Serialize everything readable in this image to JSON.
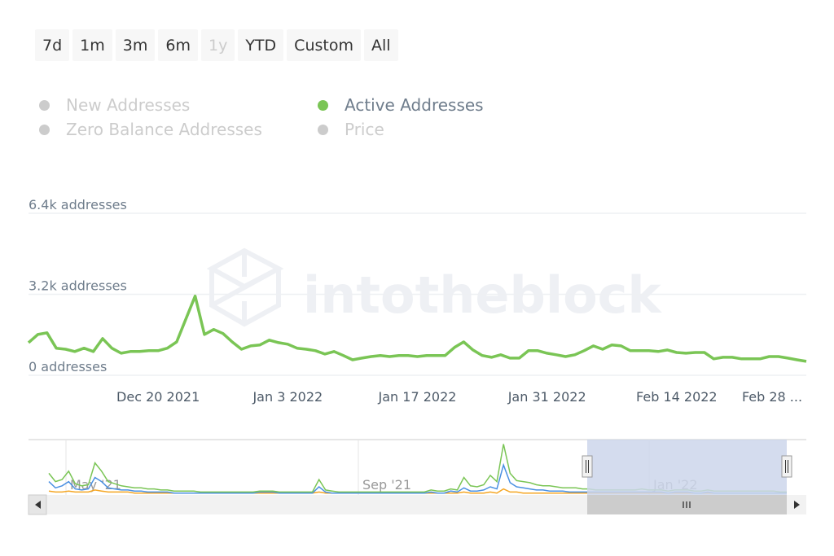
{
  "range_selector": {
    "buttons": [
      {
        "label": "7d",
        "enabled": true
      },
      {
        "label": "1m",
        "enabled": true
      },
      {
        "label": "3m",
        "enabled": true
      },
      {
        "label": "6m",
        "enabled": true
      },
      {
        "label": "1y",
        "enabled": false
      },
      {
        "label": "YTD",
        "enabled": true
      },
      {
        "label": "Custom",
        "enabled": true
      },
      {
        "label": "All",
        "enabled": true
      }
    ]
  },
  "legend": {
    "items": [
      {
        "label": "New Addresses",
        "active": false
      },
      {
        "label": "Active Addresses",
        "active": true
      },
      {
        "label": "Zero Balance Addresses",
        "active": false
      },
      {
        "label": "Price",
        "active": false
      }
    ]
  },
  "watermark": {
    "text": "intotheblock"
  },
  "colors": {
    "active_series": "#7ac555",
    "new_series": "#4a90e2",
    "zero_series": "#f5a623",
    "inactive_legend": "#cccccc",
    "axis_text": "#6f7d8c",
    "navigator_mask": "#ccd6eb"
  },
  "chart_data": {
    "type": "line",
    "title": "",
    "xlabel": "",
    "ylabel": "",
    "y_unit": "addresses",
    "ylim": [
      0,
      6400
    ],
    "y_ticks": [
      {
        "value": 0,
        "label": "0 addresses"
      },
      {
        "value": 3200,
        "label": "3.2k addresses"
      },
      {
        "value": 6400,
        "label": "6.4k addresses"
      }
    ],
    "x_start": "2021-12-06",
    "x_end": "2022-02-28",
    "x_ticks": [
      {
        "day": 14,
        "label": "Dec 20 2021"
      },
      {
        "day": 28,
        "label": "Jan 3 2022"
      },
      {
        "day": 42,
        "label": "Jan 17 2022"
      },
      {
        "day": 56,
        "label": "Jan 31 2022"
      },
      {
        "day": 70,
        "label": "Feb 14 2022"
      },
      {
        "day": 84,
        "label": "Feb 28 ..."
      }
    ],
    "grid": true,
    "series": [
      {
        "name": "Active Addresses",
        "values": [
          1290,
          1610,
          1680,
          1070,
          1030,
          940,
          1070,
          940,
          1450,
          1070,
          870,
          940,
          940,
          970,
          970,
          1070,
          1320,
          2230,
          3130,
          1610,
          1810,
          1650,
          1320,
          1030,
          1160,
          1200,
          1390,
          1290,
          1230,
          1070,
          1030,
          970,
          840,
          940,
          780,
          610,
          680,
          740,
          780,
          740,
          780,
          780,
          740,
          780,
          780,
          780,
          1100,
          1320,
          1000,
          780,
          710,
          810,
          680,
          680,
          970,
          970,
          870,
          810,
          740,
          810,
          970,
          1160,
          1030,
          1200,
          1160,
          970,
          970,
          970,
          940,
          1000,
          900,
          870,
          900,
          900,
          650,
          710,
          710,
          650,
          650,
          650,
          740,
          740,
          680,
          610,
          550
        ]
      }
    ],
    "navigator": {
      "labels": [
        "May '21",
        "Sep '21",
        "Jan '22"
      ],
      "selected_range": [
        "2021-12-06",
        "2022-02-28"
      ],
      "series": [
        {
          "name": "Active Addresses",
          "values": [
            20,
            12,
            14,
            22,
            10,
            8,
            9,
            30,
            22,
            12,
            10,
            8,
            7,
            6,
            6,
            5,
            5,
            4,
            4,
            3,
            3,
            3,
            3,
            2,
            2,
            2,
            2,
            2,
            2,
            2,
            2,
            2,
            3,
            3,
            3,
            2,
            2,
            2,
            2,
            2,
            2,
            14,
            4,
            3,
            2,
            2,
            2,
            2,
            2,
            2,
            2,
            2,
            2,
            2,
            2,
            2,
            2,
            2,
            4,
            3,
            3,
            5,
            4,
            16,
            8,
            7,
            9,
            18,
            12,
            48,
            20,
            13,
            12,
            11,
            9,
            8,
            8,
            7,
            6,
            6,
            6,
            5,
            5,
            4,
            4,
            4,
            4,
            4,
            4,
            4,
            5,
            4,
            4,
            4,
            3,
            4,
            4,
            4,
            3,
            3,
            4,
            3,
            3,
            3,
            3,
            3,
            3,
            3,
            3,
            3,
            3,
            2,
            2
          ]
        },
        {
          "name": "New Addresses",
          "values": [
            12,
            6,
            8,
            12,
            5,
            4,
            5,
            16,
            12,
            6,
            5,
            4,
            4,
            3,
            3,
            2,
            2,
            2,
            2,
            1,
            1,
            1,
            1,
            1,
            1,
            1,
            1,
            1,
            1,
            1,
            1,
            1,
            2,
            2,
            2,
            1,
            1,
            1,
            1,
            1,
            1,
            7,
            2,
            1,
            1,
            1,
            1,
            1,
            1,
            1,
            1,
            1,
            1,
            1,
            1,
            1,
            1,
            1,
            2,
            1,
            1,
            3,
            2,
            6,
            3,
            3,
            4,
            7,
            5,
            28,
            11,
            7,
            6,
            5,
            4,
            4,
            3,
            3,
            3,
            2,
            2,
            2,
            2,
            2,
            2,
            2,
            2,
            2,
            2,
            2,
            2,
            2,
            2,
            2,
            1,
            2,
            2,
            2,
            1,
            1,
            2,
            1,
            1,
            1,
            1,
            1,
            1,
            1,
            1,
            1,
            1,
            1,
            1
          ]
        },
        {
          "name": "Zero Balance Addresses",
          "values": [
            3,
            2,
            2,
            3,
            2,
            2,
            2,
            4,
            3,
            2,
            2,
            2,
            2,
            1,
            1,
            1,
            1,
            1,
            1,
            1,
            1,
            1,
            1,
            1,
            1,
            1,
            1,
            1,
            1,
            1,
            1,
            1,
            1,
            1,
            1,
            1,
            1,
            1,
            1,
            1,
            1,
            2,
            1,
            1,
            1,
            1,
            1,
            1,
            1,
            1,
            1,
            1,
            1,
            1,
            1,
            1,
            1,
            1,
            1,
            1,
            1,
            1,
            1,
            2,
            1,
            1,
            1,
            2,
            1,
            5,
            2,
            2,
            1,
            1,
            1,
            1,
            1,
            1,
            1,
            1,
            1,
            1,
            1,
            1,
            1,
            1,
            1,
            1,
            1,
            1,
            1,
            1,
            1,
            1,
            1,
            1,
            1,
            1,
            1,
            1,
            1,
            1,
            1,
            1,
            1,
            1,
            1,
            1,
            1,
            1,
            1,
            1,
            1
          ]
        }
      ]
    }
  }
}
